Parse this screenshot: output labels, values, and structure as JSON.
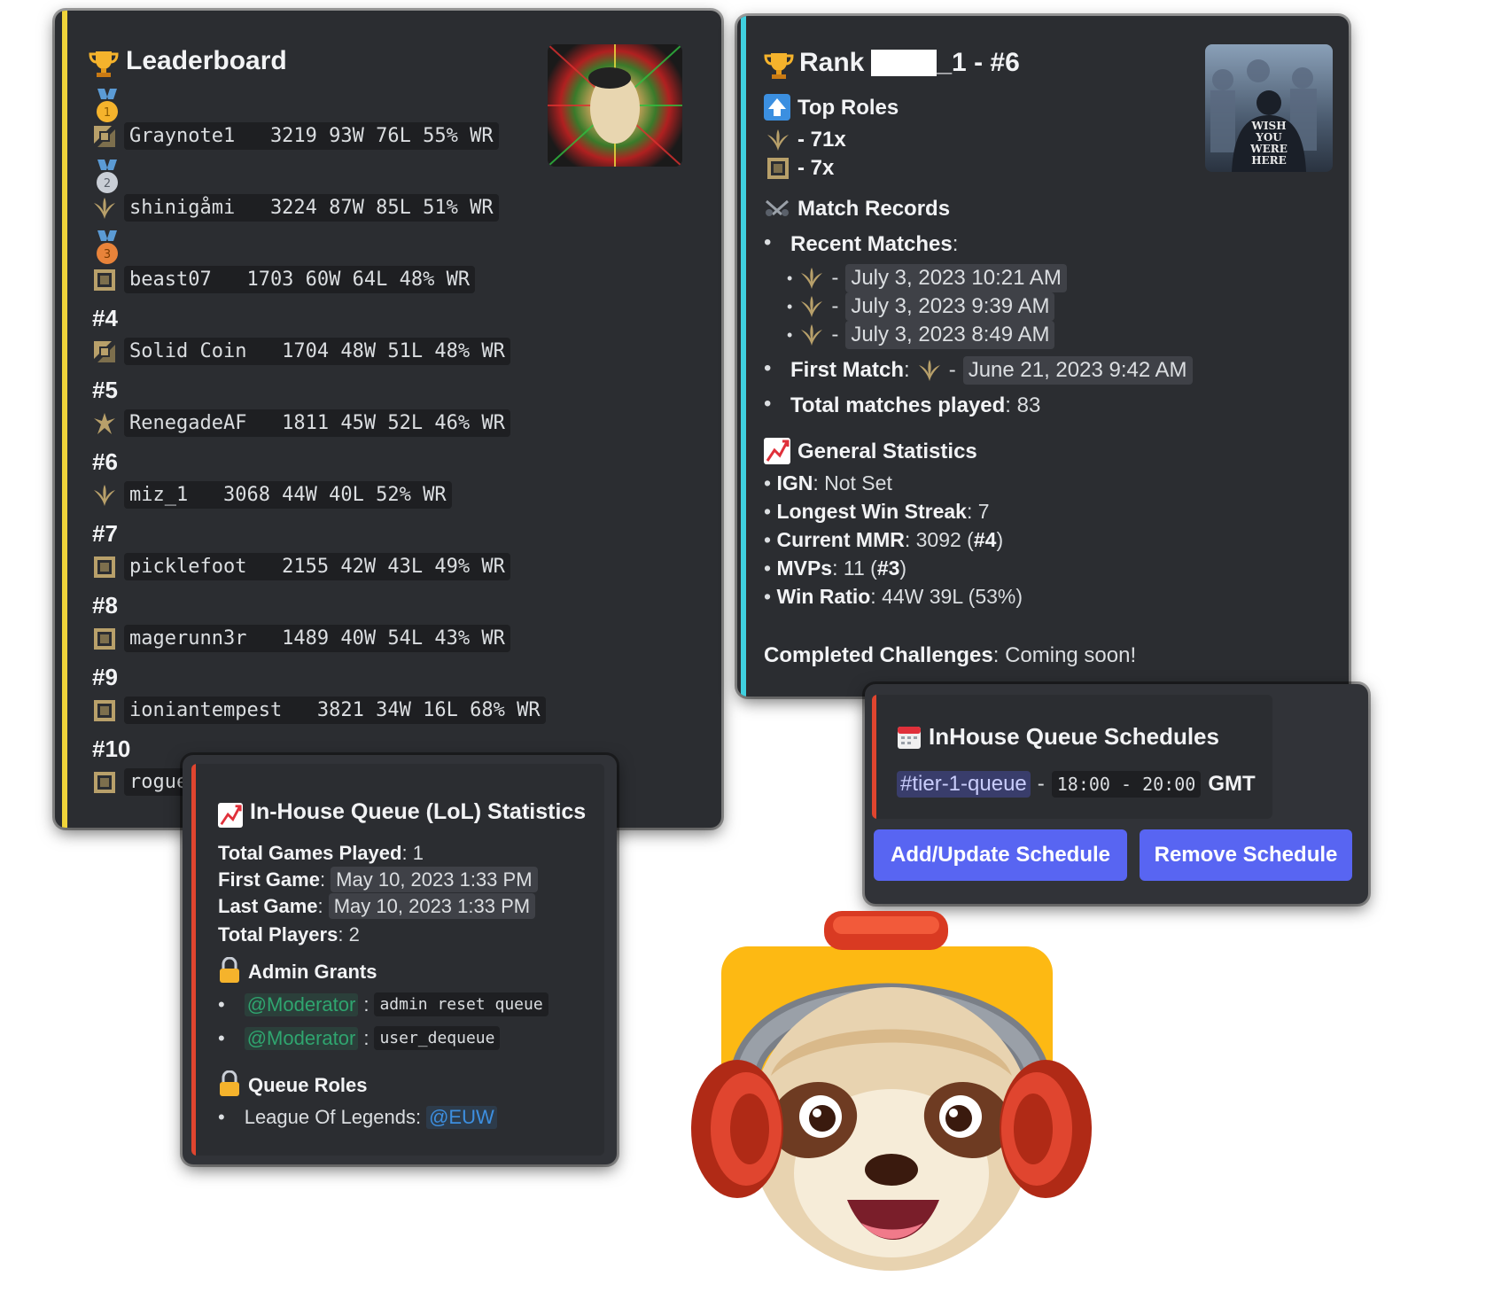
{
  "leaderboard": {
    "title": "Leaderboard",
    "entries": [
      {
        "rank": "1",
        "text": "Graynote1   3219 93W 76L 55% WR",
        "role": "top"
      },
      {
        "rank": "2",
        "text": "shinigåmi   3224 87W 85L 51% WR",
        "role": "jungle"
      },
      {
        "rank": "3",
        "text": "beast07   1703 60W 64L 48% WR",
        "role": "support"
      },
      {
        "rank": "#4",
        "text": "Solid Coin   1704 48W 51L 48% WR",
        "role": "top"
      },
      {
        "rank": "#5",
        "text": "RenegadeAF   1811 45W 52L 46% WR",
        "role": "mid"
      },
      {
        "rank": "#6",
        "text": "miz_1   3068 44W 40L 52% WR",
        "role": "jungle"
      },
      {
        "rank": "#7",
        "text": "picklefoot   2155 42W 43L 49% WR",
        "role": "support"
      },
      {
        "rank": "#8",
        "text": "magerunn3r   1489 40W 54L 43% WR",
        "role": "support"
      },
      {
        "rank": "#9",
        "text": "ioniantempest   3821 34W 16L 68% WR",
        "role": "support"
      },
      {
        "rank": "#10",
        "text": "rogue",
        "role": "support"
      }
    ],
    "accent_color": "#f0d43a"
  },
  "rank_card": {
    "title_prefix": "Rank",
    "title_suffix": "_1 - #6",
    "top_roles_heading": "Top Roles",
    "top_roles": [
      {
        "role": "jungle",
        "count": "- 71x"
      },
      {
        "role": "support",
        "count": "- 7x"
      }
    ],
    "match_records_heading": "Match Records",
    "recent_matches_label": "Recent Matches",
    "recent_matches": [
      "July 3, 2023 10:21 AM",
      "July 3, 2023 9:39 AM",
      "July 3, 2023 8:49 AM"
    ],
    "first_match_label": "First Match",
    "first_match": "June 21, 2023 9:42 AM",
    "total_matches_label": "Total matches played",
    "total_matches": "83",
    "general_stats_heading": "General Statistics",
    "stats": [
      {
        "label": "IGN",
        "value": "Not Set"
      },
      {
        "label": "Longest Win Streak",
        "value": "7"
      },
      {
        "label": "Current MMR",
        "value": "3092 (",
        "bold_tail": "#4",
        "end": ")"
      },
      {
        "label": "MVPs",
        "value": "11 (",
        "bold_tail": "#3",
        "end": ")"
      },
      {
        "label": "Win Ratio",
        "value": "44W 39L (53%)"
      }
    ],
    "challenges_label": "Completed Challenges",
    "challenges_value": "Coming soon!",
    "accent_color": "#3fd0e0",
    "thumbnail_text": "WISH YOU WERE HERE"
  },
  "schedule_card": {
    "title": "InHouse Queue Schedules",
    "channel": "#tier-1-queue",
    "dash": "-",
    "time_range": "18:00 - 20:00",
    "timezone": "GMT",
    "add_button": "Add/Update Schedule",
    "remove_button": "Remove Schedule",
    "accent_color": "#e0452f"
  },
  "stats_card": {
    "title": "In-House Queue (LoL) Statistics",
    "lines": [
      {
        "label": "Total Games Played",
        "value": "1"
      },
      {
        "label": "First Game",
        "value": "May 10, 2023 1:33 PM"
      },
      {
        "label": "Last Game",
        "value": "May 10, 2023 1:33 PM"
      },
      {
        "label": "Total Players",
        "value": "2"
      }
    ],
    "admin_heading": "Admin Grants",
    "admin_grants": [
      {
        "mention": "@Moderator",
        "command": "admin reset queue"
      },
      {
        "mention": "@Moderator",
        "command": "user_dequeue"
      }
    ],
    "queue_roles_heading": "Queue Roles",
    "queue_role_label": "League Of Legends:",
    "queue_role_mention": "@EUW",
    "accent_color": "#e0452f"
  }
}
